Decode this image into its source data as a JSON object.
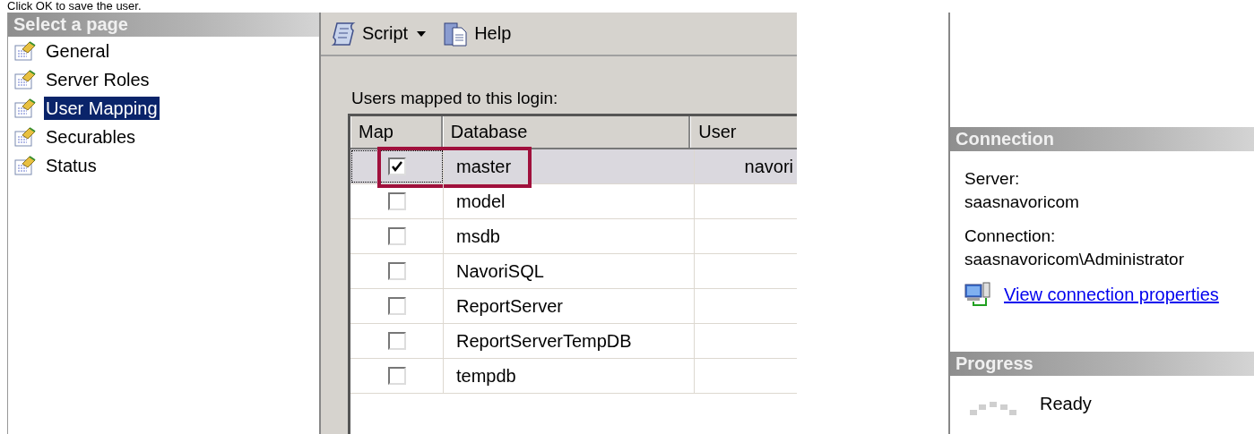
{
  "caption": "Click OK to save the user.",
  "sidebar": {
    "title": "Select a page",
    "items": [
      {
        "label": "General",
        "selected": false
      },
      {
        "label": "Server Roles",
        "selected": false
      },
      {
        "label": "User Mapping",
        "selected": true
      },
      {
        "label": "Securables",
        "selected": false
      },
      {
        "label": "Status",
        "selected": false
      }
    ]
  },
  "toolbar": {
    "buttons": [
      {
        "kind": "script",
        "label": "Script",
        "dropdown": true
      },
      {
        "kind": "help",
        "label": "Help",
        "dropdown": false
      }
    ]
  },
  "mapping": {
    "label": "Users mapped to this login:",
    "columns": [
      "Map",
      "Database",
      "User"
    ],
    "rows": [
      {
        "checked": true,
        "database": "master",
        "user": "navori",
        "selected": true,
        "annotated": true
      },
      {
        "checked": false,
        "database": "model",
        "selected": false,
        "annotated": false
      },
      {
        "checked": false,
        "database": "msdb",
        "selected": false,
        "annotated": false
      },
      {
        "checked": false,
        "database": "NavoriSQL",
        "selected": false,
        "annotated": false
      },
      {
        "checked": false,
        "database": "ReportServer",
        "selected": false,
        "annotated": false
      },
      {
        "checked": false,
        "database": "ReportServerTempDB",
        "selected": false,
        "annotated": false
      },
      {
        "checked": false,
        "database": "tempdb",
        "selected": false,
        "annotated": false
      }
    ]
  },
  "connection": {
    "title": "Connection",
    "fields": [
      {
        "label": "Server:",
        "value": "saasnavoricom"
      },
      {
        "label": "Connection:",
        "value": "saasnavoricom\\Administrator"
      }
    ],
    "link": "View connection properties"
  },
  "progress": {
    "title": "Progress",
    "status": "Ready"
  }
}
